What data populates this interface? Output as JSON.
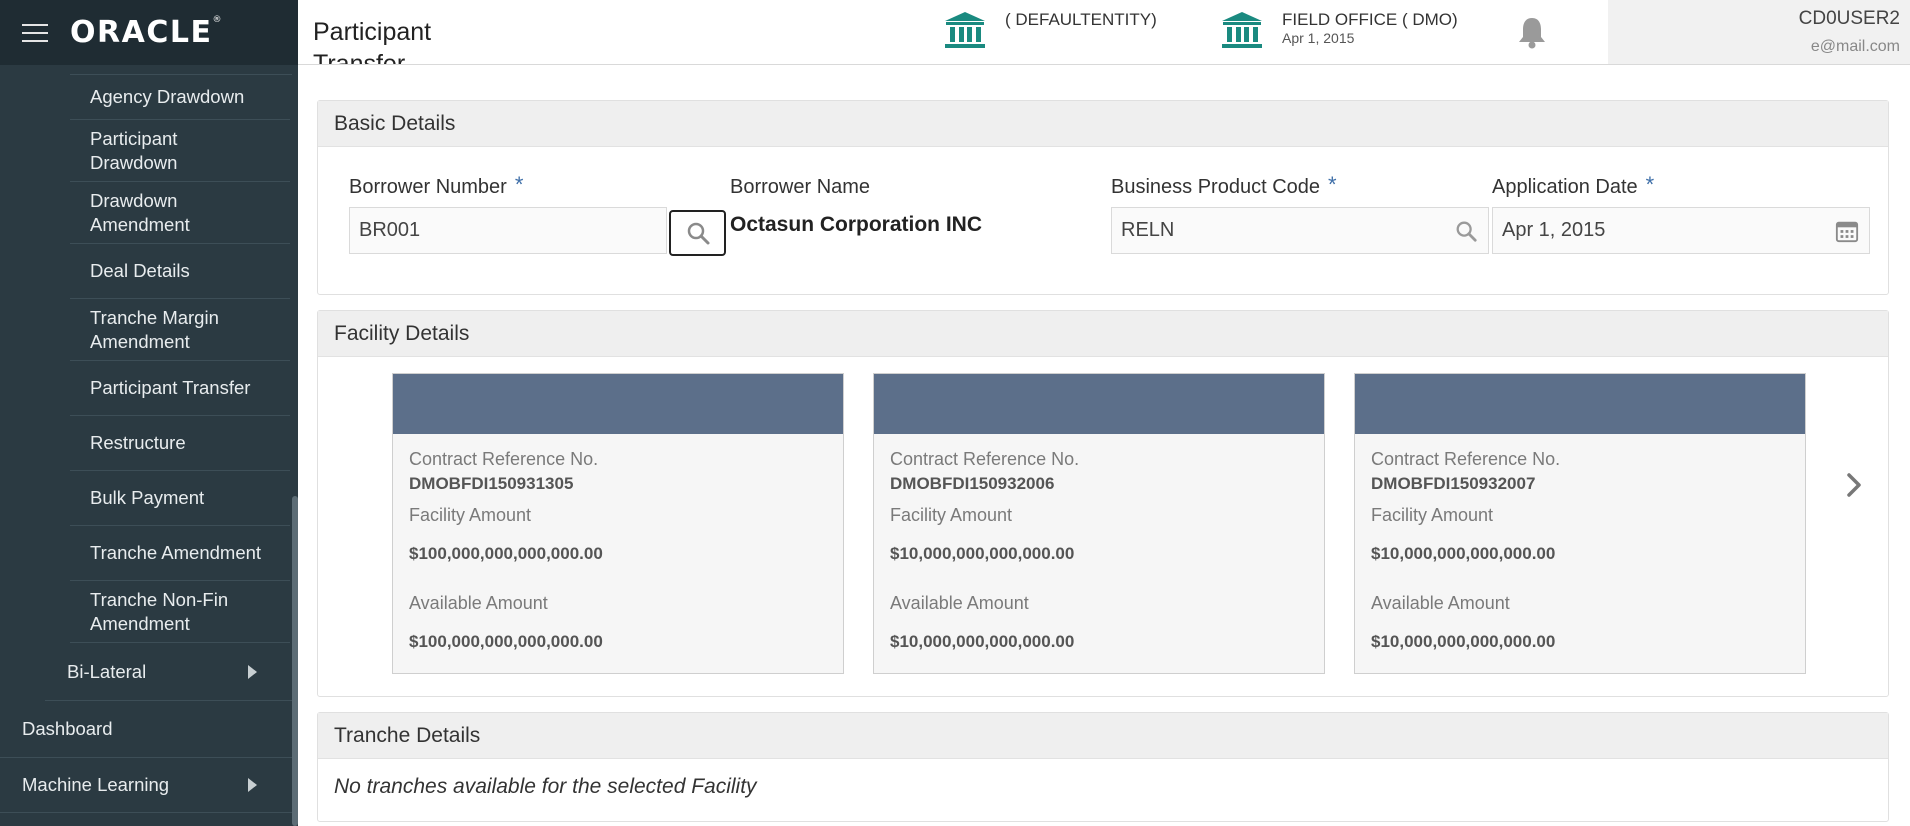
{
  "app": {
    "logo": "ORACLE"
  },
  "sidebar": {
    "sub_items": [
      {
        "label": "Agency Drawdown"
      },
      {
        "label": "Participant Drawdown"
      },
      {
        "label": "Drawdown Amendment"
      },
      {
        "label": "Deal Details"
      },
      {
        "label": "Tranche Margin Amendment"
      },
      {
        "label": "Participant Transfer"
      },
      {
        "label": "Restructure"
      },
      {
        "label": "Bulk Payment"
      },
      {
        "label": "Tranche Amendment"
      },
      {
        "label": "Tranche Non-Fin Amendment"
      }
    ],
    "group_item": {
      "label": "Bi-Lateral"
    },
    "main_items": [
      {
        "label": "Dashboard"
      },
      {
        "label": "Machine Learning"
      }
    ]
  },
  "header": {
    "page_title": "Participant Transfer",
    "entity1": {
      "name": "( DEFAULTENTITY)"
    },
    "entity2": {
      "name": "FIELD OFFICE  ( DMO)",
      "date": "Apr 1, 2015"
    },
    "user": {
      "name": "CD0USER2",
      "email": "e@mail.com"
    }
  },
  "basic_details": {
    "title": "Basic Details",
    "borrower_number": {
      "label": "Borrower Number",
      "value": "BR001"
    },
    "borrower_name": {
      "label": "Borrower Name",
      "value": "Octasun Corporation INC"
    },
    "business_product_code": {
      "label": "Business Product Code",
      "value": "RELN"
    },
    "application_date": {
      "label": "Application Date",
      "value": "Apr 1, 2015"
    },
    "required_mark": "*"
  },
  "facility_details": {
    "title": "Facility Details",
    "contract_ref_label": "Contract Reference No.",
    "facility_amount_label": "Facility Amount",
    "available_amount_label": "Available Amount",
    "cards": [
      {
        "ref": "DMOBFDI150931305",
        "facility_amount": "$100,000,000,000,000.00",
        "available_amount": "$100,000,000,000,000.00"
      },
      {
        "ref": "DMOBFDI150932006",
        "facility_amount": "$10,000,000,000,000.00",
        "available_amount": "$10,000,000,000,000.00"
      },
      {
        "ref": "DMOBFDI150932007",
        "facility_amount": "$10,000,000,000,000.00",
        "available_amount": "$10,000,000,000,000.00"
      }
    ]
  },
  "tranche_details": {
    "title": "Tranche Details",
    "empty_message": "No tranches available for the selected Facility"
  },
  "colors": {
    "sidebar": "#2b3a42",
    "accent": "#3f6fa8",
    "card_band": "#5c6f8a",
    "bank_icon": "#1a8a80"
  }
}
